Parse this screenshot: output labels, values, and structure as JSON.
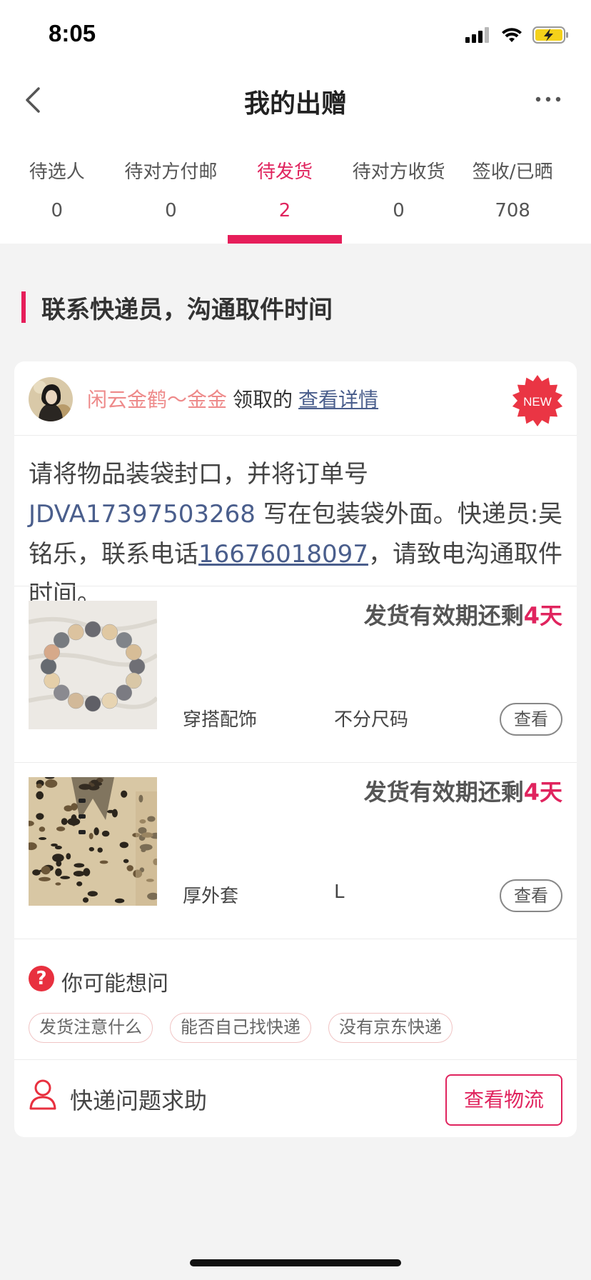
{
  "status": {
    "time": "8:05"
  },
  "nav": {
    "title": "我的出赠"
  },
  "tabs": [
    {
      "label": "待选人",
      "count": "0"
    },
    {
      "label": "待对方付邮",
      "count": "0"
    },
    {
      "label": "待发货",
      "count": "2",
      "active": true
    },
    {
      "label": "待对方收货",
      "count": "0"
    },
    {
      "label": "签收/已晒",
      "count": "708"
    }
  ],
  "section": {
    "title": "联系快递员，沟通取件时间"
  },
  "claim": {
    "user": "闲云金鹤～金金",
    "action": "领取的",
    "details_link": "查看详情",
    "badge": "NEW"
  },
  "instruction": {
    "part1": "请将物品装袋封口，并将订单号 ",
    "order_no": "JDVA17397503268",
    "part2": " 写在包装袋外面。快递员:吴铭乐，联系电话",
    "phone": "16676018097",
    "part3": "，请致电沟通取件时间。"
  },
  "items": [
    {
      "deadline_prefix": "发货有效期还剩",
      "deadline_days": "4天",
      "category": "穿搭配饰",
      "size": "不分尺码",
      "view_label": "查看",
      "image": "bracelet"
    },
    {
      "deadline_prefix": "发货有效期还剩",
      "deadline_days": "4天",
      "category": "厚外套",
      "size": "L",
      "view_label": "查看",
      "image": "leopard-coat"
    }
  ],
  "faq": {
    "title": "你可能想问",
    "icon": "question-icon",
    "chips": [
      "发货注意什么",
      "能否自己找快递",
      "没有京东快递"
    ]
  },
  "help": {
    "label": "快递问题求助",
    "logistics_button": "查看物流"
  },
  "colors": {
    "accent": "#e0245e",
    "link": "#4a5e8c",
    "user_name": "#ee8a8a"
  }
}
